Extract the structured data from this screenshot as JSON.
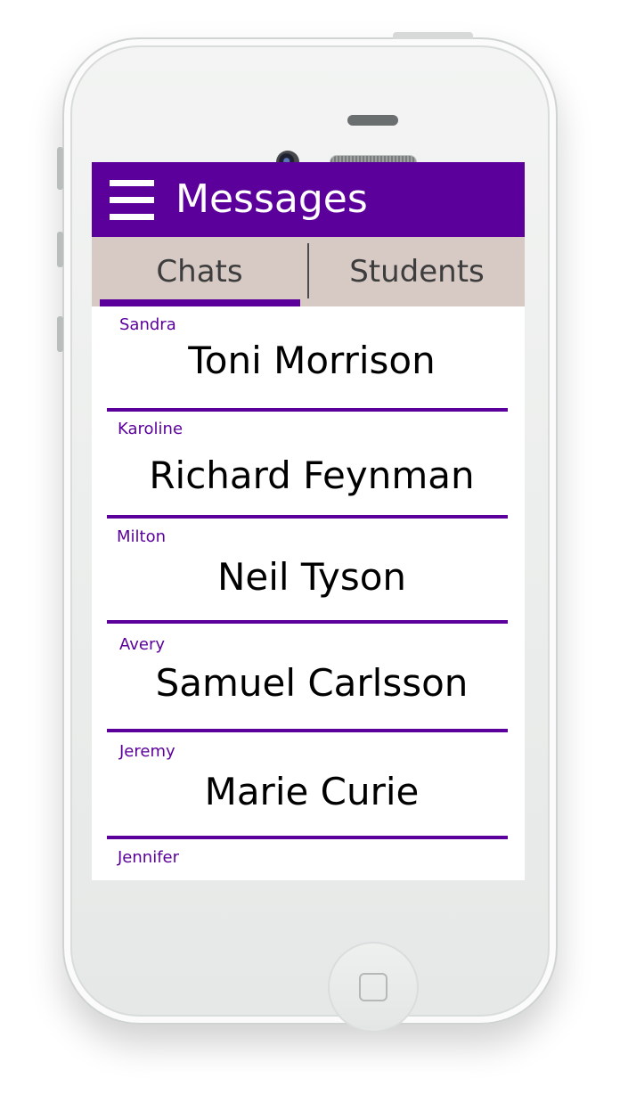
{
  "header": {
    "title": "Messages",
    "menu_icon": "hamburger-menu-icon"
  },
  "tabs": [
    {
      "label": "Chats",
      "active": true
    },
    {
      "label": "Students",
      "active": false
    }
  ],
  "chats": [
    {
      "sender": "Sandra",
      "name": "Toni Morrison"
    },
    {
      "sender": "Karoline",
      "name": "Richard Feynman"
    },
    {
      "sender": "Milton",
      "name": "Neil  Tyson"
    },
    {
      "sender": "Avery",
      "name": "Samuel Carlsson"
    },
    {
      "sender": "Jeremy",
      "name": "Marie Curie"
    },
    {
      "sender": "Jennifer",
      "name": ""
    }
  ],
  "colors": {
    "accent": "#5b009b",
    "tab_bar": "#d7c9c4"
  }
}
